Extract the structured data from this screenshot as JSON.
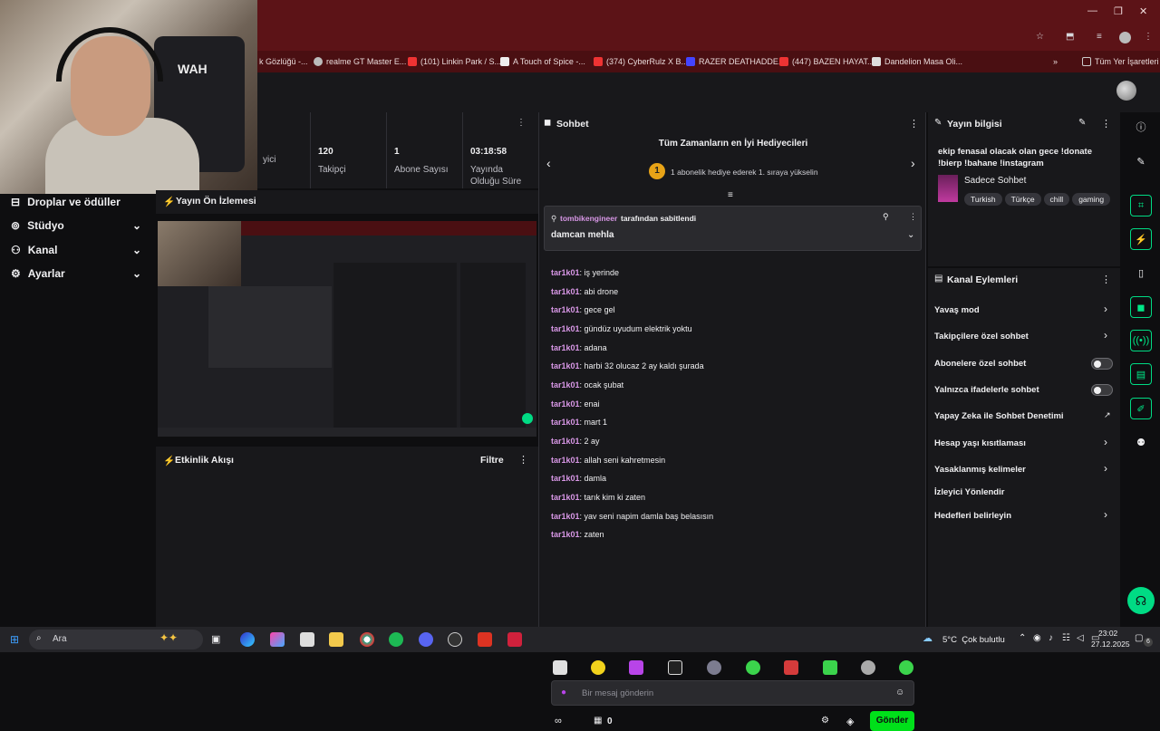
{
  "bookmarks": [
    {
      "label": "k Gözlüğü -...",
      "color": "#c77"
    },
    {
      "label": "realme GT Master E...",
      "color": "#bbb"
    },
    {
      "label": "(101) Linkin Park / S...",
      "color": "#e33"
    },
    {
      "label": "A Touch of Spice -...",
      "color": "#eee"
    },
    {
      "label": "(374) CyberRulz X B...",
      "color": "#e33"
    },
    {
      "label": "RAZER DEATHADDE...",
      "color": "#44f"
    },
    {
      "label": "(447) BAZEN HAYAT...",
      "color": "#e33"
    },
    {
      "label": "Dandelion Masa Oli...",
      "color": "#ddd"
    },
    {
      "label": "Tüm Yer İşaretleri",
      "color": "#ccc"
    }
  ],
  "webcam": {
    "cap_text": "WAH"
  },
  "nav": {
    "items": [
      {
        "label": "Droplar ve ödüller",
        "icon": "gift-icon"
      },
      {
        "label": "Stüdyo",
        "icon": "studio-icon"
      },
      {
        "label": "Kanal",
        "icon": "channel-icon"
      },
      {
        "label": "Ayarlar",
        "icon": "gear-icon"
      }
    ]
  },
  "stats": [
    {
      "value": "",
      "label": "yici"
    },
    {
      "value": "120",
      "label": "Takipçi"
    },
    {
      "value": "1",
      "label": "Abone Sayısı"
    },
    {
      "value": "03:18:58",
      "label": "Yayında Olduğu Süre"
    }
  ],
  "preview": {
    "title": "Yayın Ön İzlemesi"
  },
  "activity": {
    "title": "Etkinlik Akışı",
    "filter": "Filtre"
  },
  "chat": {
    "title": "Sohbet",
    "leaderboard_title": "Tüm Zamanların en İyi Hediyecileri",
    "leaderboard_rank": "1",
    "leaderboard_sub": "1 abonelik hediye ederek 1. sıraya yükselin",
    "pinned_by_user": "tombikengineer",
    "pinned_by_suffix": "tarafından sabitlendi",
    "pinned_message": "damcan mehla",
    "messages": [
      {
        "user": "tar1k01",
        "text": "iş yerinde"
      },
      {
        "user": "tar1k01",
        "text": "abi drone"
      },
      {
        "user": "tar1k01",
        "text": "gece gel"
      },
      {
        "user": "tar1k01",
        "text": "gündüz uyudum elektrik yoktu"
      },
      {
        "user": "tar1k01",
        "text": "adana"
      },
      {
        "user": "tar1k01",
        "text": "harbi 32 olucaz 2 ay kaldı şurada"
      },
      {
        "user": "tar1k01",
        "text": "ocak şubat"
      },
      {
        "user": "tar1k01",
        "text": "enai"
      },
      {
        "user": "tar1k01",
        "text": "mart 1"
      },
      {
        "user": "tar1k01",
        "text": "2 ay"
      },
      {
        "user": "tar1k01",
        "text": "allah seni kahretmesin"
      },
      {
        "user": "tar1k01",
        "text": "damla"
      },
      {
        "user": "tar1k01",
        "text": "tarık kim ki zaten"
      },
      {
        "user": "tar1k01",
        "text": "yav seni napim damla baş belasısın"
      },
      {
        "user": "tar1k01",
        "text": "zaten"
      }
    ],
    "input_placeholder": "Bir mesaj gönderin",
    "points": "0",
    "send_label": "Gönder"
  },
  "info": {
    "title": "Yayın bilgisi",
    "stream_title": "ekip fenasal olacak olan gece !donate !bierp !bahane !instagram",
    "category": "Sadece Sohbet",
    "tags": [
      "Turkish",
      "Türkçe",
      "chill",
      "gaming"
    ]
  },
  "actions": {
    "title": "Kanal Eylemleri",
    "items": [
      {
        "label": "Yavaş mod",
        "control": "chevron"
      },
      {
        "label": "Takipçilere özel sohbet",
        "control": "chevron"
      },
      {
        "label": "Abonelere özel sohbet",
        "control": "toggle"
      },
      {
        "label": "Yalnızca ifadelerle sohbet",
        "control": "toggle"
      },
      {
        "label": "Yapay Zeka ile Sohbet Denetimi",
        "control": "external"
      },
      {
        "label": "Hesap yaşı kısıtlaması",
        "control": "chevron"
      },
      {
        "label": "Yasaklanmış kelimeler",
        "control": "chevron"
      },
      {
        "label": "İzleyici Yönlendir",
        "control": "none"
      },
      {
        "label": "Hedefleri belirleyin",
        "control": "chevron"
      }
    ]
  },
  "taskbar": {
    "search_placeholder": "Ara",
    "weather": "5°C  Çok bulutlu",
    "time": "23:02",
    "date": "27.12.2025",
    "notif_count": "6"
  },
  "colors": {
    "accent_green": "#00db84",
    "username": "#d897e6",
    "send_button": "#00e01a",
    "rank_gold": "#e8a317"
  }
}
